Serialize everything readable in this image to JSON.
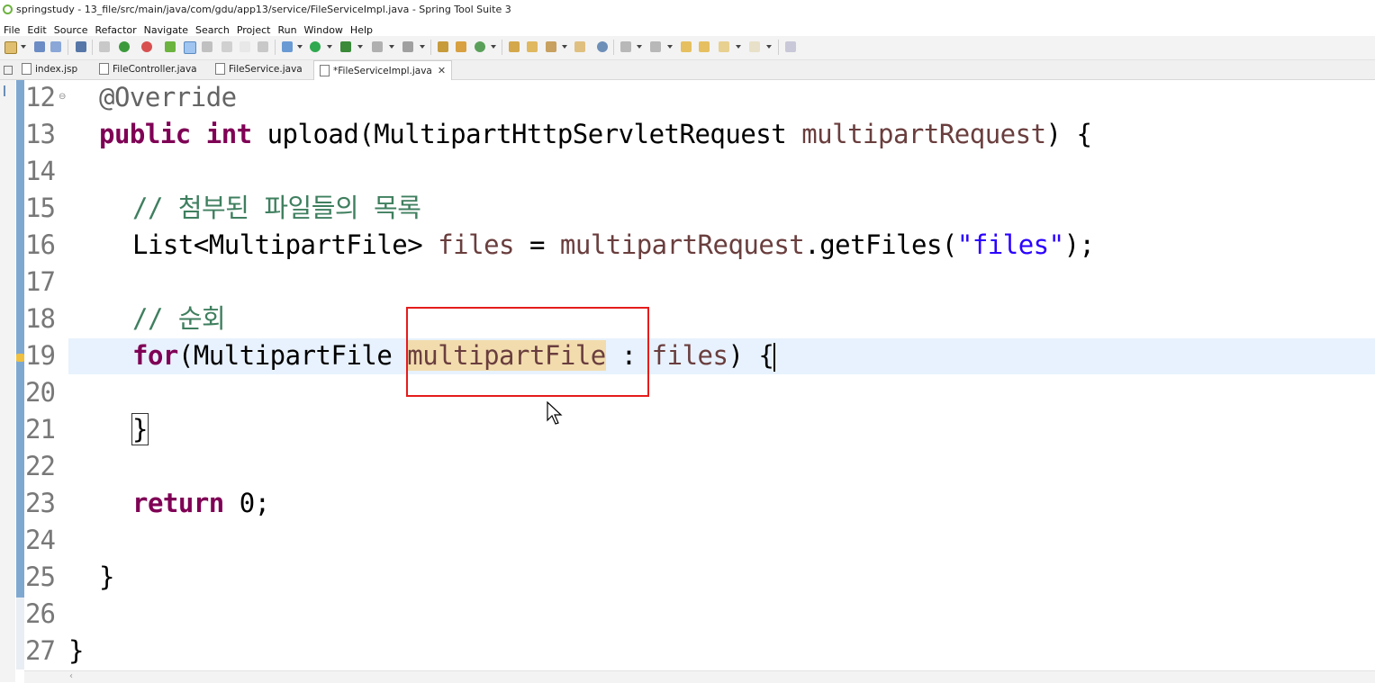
{
  "window": {
    "title": "springstudy - 13_file/src/main/java/com/gdu/app13/service/FileServiceImpl.java - Spring Tool Suite 3"
  },
  "menu": [
    "File",
    "Edit",
    "Source",
    "Refactor",
    "Navigate",
    "Search",
    "Project",
    "Run",
    "Window",
    "Help"
  ],
  "tabs": [
    {
      "label": "index.jsp",
      "active": false
    },
    {
      "label": "FileController.java",
      "active": false
    },
    {
      "label": "FileService.java",
      "active": false
    },
    {
      "label": "*FileServiceImpl.java",
      "active": true,
      "close": "✕"
    }
  ],
  "editor": {
    "line_numbers": [
      "12",
      "13",
      "14",
      "15",
      "16",
      "17",
      "18",
      "19",
      "20",
      "21",
      "22",
      "23",
      "24",
      "25",
      "26",
      "27"
    ],
    "fold_marker": "⊖",
    "l12": {
      "annotation": "@Override"
    },
    "l13": {
      "kw1": "public",
      "kw2": "int",
      "method": "upload(MultipartHttpServletRequest ",
      "param": "multipartRequest",
      "end": ") {"
    },
    "l15": {
      "comment": "// 첨부된 파일들의 목록"
    },
    "l16": {
      "type": "List<MultipartFile> ",
      "var": "files",
      "mid": " = ",
      "var2": "multipartRequest",
      "call": ".getFiles(",
      "str": "\"files\"",
      "end": ");"
    },
    "l18": {
      "comment": "// 순회"
    },
    "l19": {
      "kw": "for",
      "pre": "(MultipartFile ",
      "occ": "multipartFile",
      "mid": " : ",
      "var": "files",
      "end": ") {"
    },
    "l21": {
      "brace": "}"
    },
    "l23": {
      "kw": "return",
      "end": " 0;"
    },
    "l25": {
      "brace": "}"
    },
    "l27": {
      "brace": "}"
    }
  },
  "colors": {
    "keyword": "#7f0055",
    "comment": "#3f7f5f",
    "string": "#2a00ff",
    "variable": "#6a3e3e",
    "occurrence_highlight": "#f2dcae",
    "current_line": "#e8f2fe",
    "annotation_box": "#e51c1c"
  }
}
